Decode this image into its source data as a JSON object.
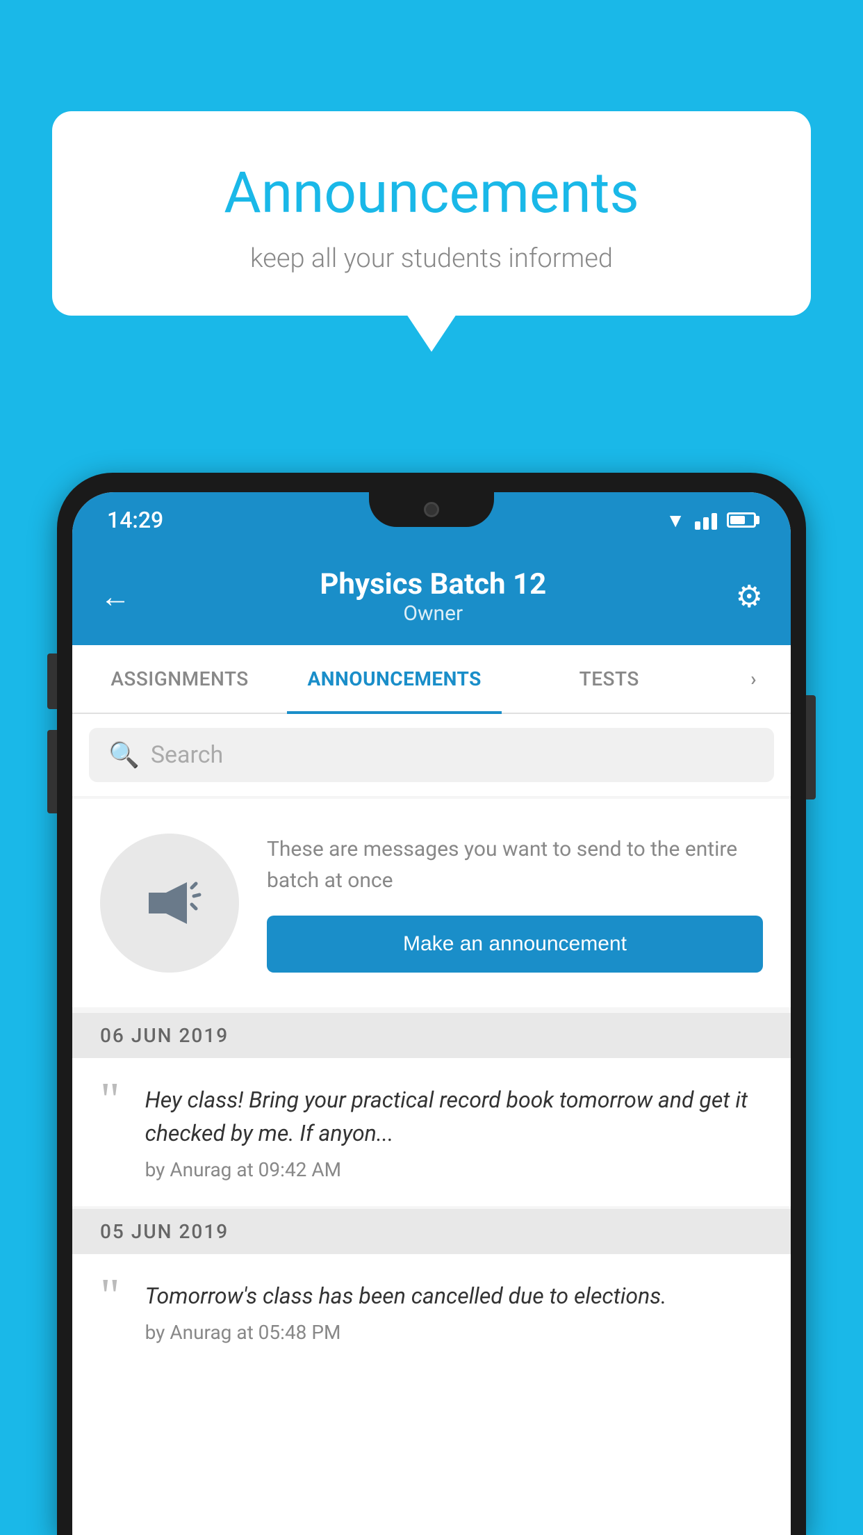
{
  "background_color": "#1ab8e8",
  "speech_bubble": {
    "title": "Announcements",
    "subtitle": "keep all your students informed"
  },
  "status_bar": {
    "time": "14:29"
  },
  "header": {
    "title": "Physics Batch 12",
    "subtitle": "Owner",
    "back_label": "←",
    "gear_label": "⚙"
  },
  "tabs": [
    {
      "label": "ASSIGNMENTS",
      "active": false
    },
    {
      "label": "ANNOUNCEMENTS",
      "active": true
    },
    {
      "label": "TESTS",
      "active": false
    },
    {
      "label": "›",
      "active": false
    }
  ],
  "search": {
    "placeholder": "Search"
  },
  "announcement_empty": {
    "description": "These are messages you want to send to the entire batch at once",
    "button_label": "Make an announcement"
  },
  "announcements": [
    {
      "date": "06  JUN  2019",
      "text": "Hey class! Bring your practical record book tomorrow and get it checked by me. If anyon...",
      "meta": "by Anurag at 09:42 AM"
    },
    {
      "date": "05  JUN  2019",
      "text": "Tomorrow's class has been cancelled due to elections.",
      "meta": "by Anurag at 05:48 PM"
    }
  ]
}
